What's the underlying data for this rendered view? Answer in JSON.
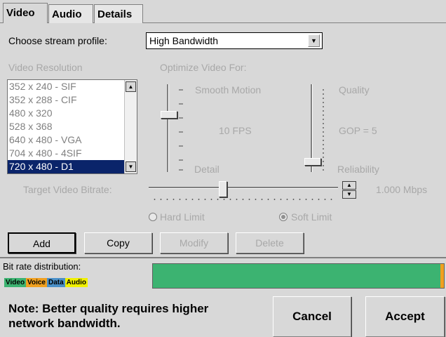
{
  "tabs": [
    {
      "label": "Video",
      "active": true
    },
    {
      "label": "Audio",
      "active": false
    },
    {
      "label": "Details",
      "active": false
    }
  ],
  "profile": {
    "label": "Choose stream profile:",
    "value": "High Bandwidth"
  },
  "resolution": {
    "label": "Video Resolution",
    "items": [
      "352 x 240 - SIF",
      "352 x 288 - CIF",
      "480 x 320",
      "528 x 368",
      "640 x 480 - VGA",
      "704 x 480 - 4SIF",
      "720 x 480 - D1"
    ],
    "selected_index": 6
  },
  "optimize": {
    "label": "Optimize Video For:",
    "left_top": "Smooth Motion",
    "left_mid": "10 FPS",
    "left_bottom": "Detail",
    "right_top": "Quality",
    "right_mid": "GOP = 5",
    "right_bottom": "Reliability"
  },
  "bitrate": {
    "label": "Target Video Bitrate:",
    "value_text": "1.000 Mbps",
    "hard_limit_label": "Hard Limit",
    "soft_limit_label": "Soft Limit",
    "selected_limit": "soft"
  },
  "actions": {
    "add": "Add",
    "copy": "Copy",
    "modify": "Modify",
    "delete": "Delete"
  },
  "distribution": {
    "label": "Bit rate distribution:",
    "legend": [
      {
        "label": "Video",
        "color": "#3cb371"
      },
      {
        "label": "Voice",
        "color": "#f0a020"
      },
      {
        "label": "Data",
        "color": "#4a90c8"
      },
      {
        "label": "Audio",
        "color": "#f0f000"
      }
    ],
    "bar_color": "#3cb371",
    "end_marker_color": "#f0a020"
  },
  "footer": {
    "note_line1": "Note: Better quality requires higher",
    "note_line2": "network bandwidth.",
    "cancel": "Cancel",
    "accept": "Accept"
  }
}
